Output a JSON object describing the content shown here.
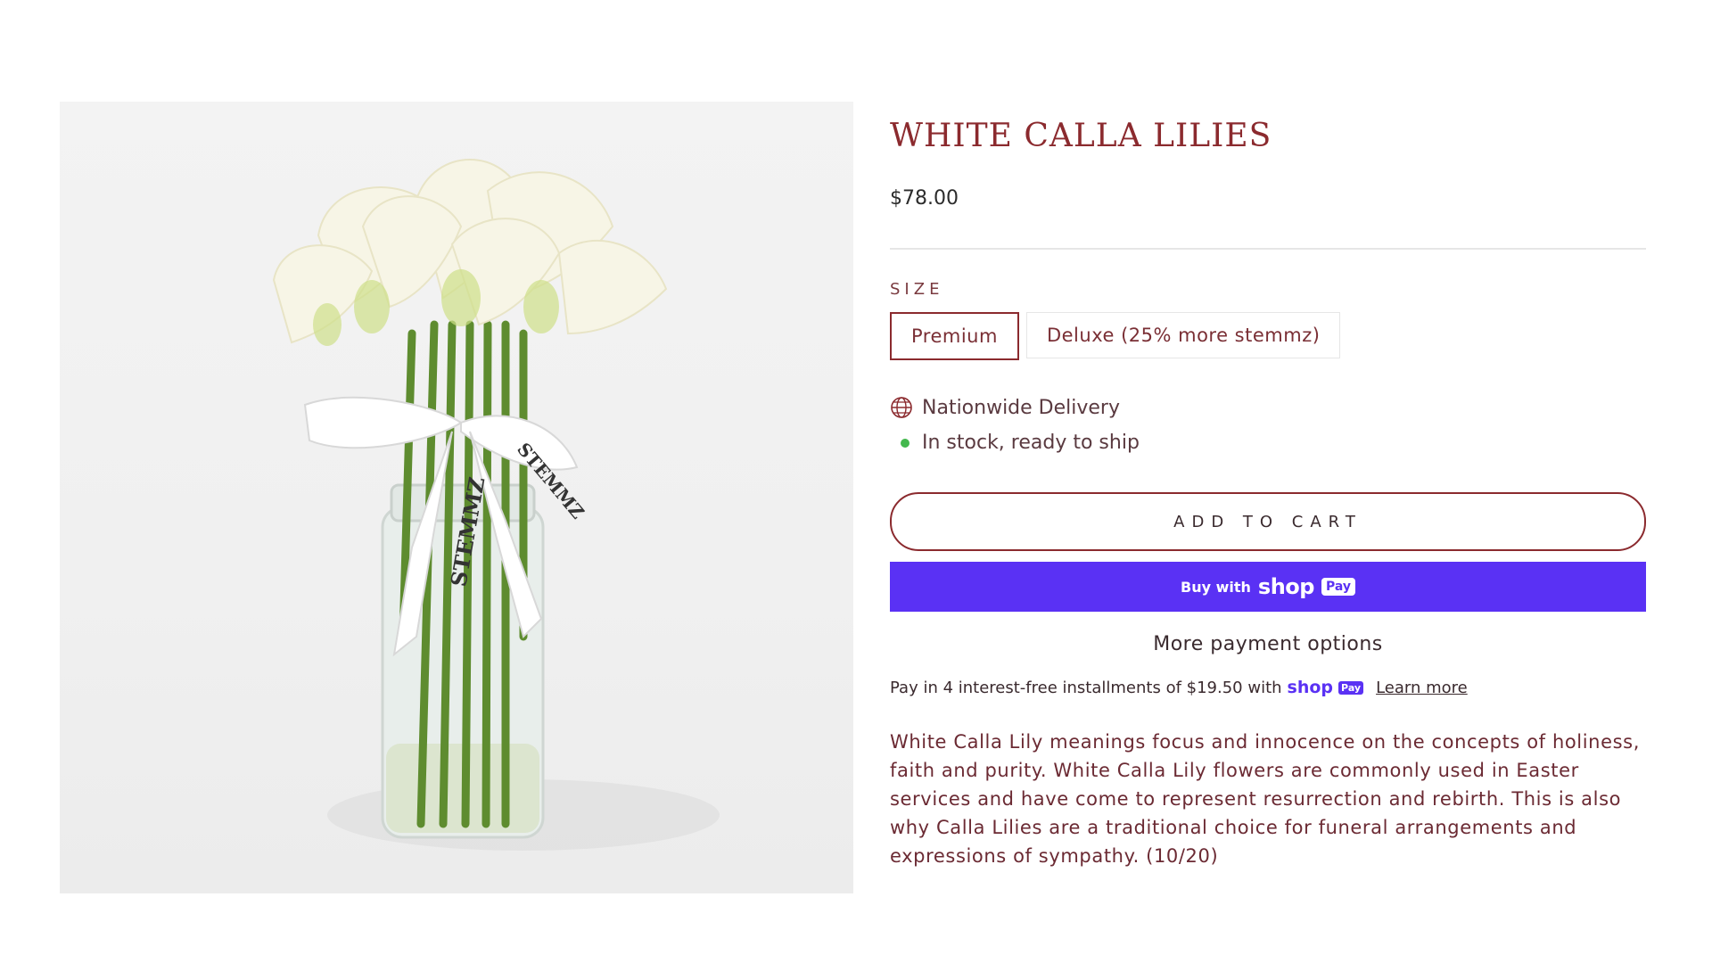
{
  "product": {
    "title": "WHITE CALLA LILIES",
    "price": "$78.00",
    "size_label": "SIZE",
    "options": [
      "Premium",
      "Deluxe (25% more stemmz)"
    ],
    "selected_option": "Premium",
    "delivery_text": "Nationwide Delivery",
    "stock_text": "In stock, ready to ship",
    "add_to_cart": "ADD TO CART",
    "shop_pay": {
      "buy_with": "Buy with",
      "shop": "shop",
      "pay": "Pay"
    },
    "more_payment": "More payment options",
    "installments": {
      "text": "Pay in 4 interest-free installments of $19.50 with",
      "shop": "shop",
      "pay": "Pay",
      "learn_more": "Learn more"
    },
    "description": "White Calla Lily meanings focus and innocence on the concepts of holiness, faith and purity. White Calla Lily flowers are commonly used in Easter services and have come to represent resurrection and rebirth. This is also why Calla Lilies are a traditional choice for funeral arrangements and expressions of sympathy. (10/20)"
  },
  "image": {
    "ribbon_text": "STEMMZ"
  },
  "colors": {
    "accent": "#8b2a2e",
    "shop_pay": "#5a31f4",
    "in_stock": "#44b84e"
  }
}
